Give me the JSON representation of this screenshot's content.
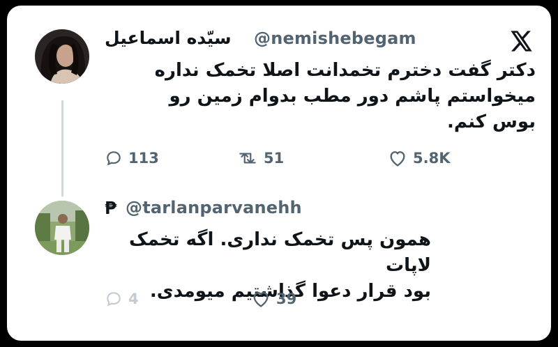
{
  "tweet1": {
    "display_name": "سیّده اسماعیل",
    "handle": "@nemishebegam",
    "lines": [
      "دکتر گفت دخترم تخمدانت اصلا تخمک نداره",
      "میخواستم پاشم دور مطب بدوام زمین رو",
      "بوس کنم."
    ],
    "replies": "113",
    "reposts": "51",
    "likes": "5.8K"
  },
  "tweet2": {
    "name_glyph": "₱",
    "handle": "@tarlanparvanehh",
    "lines": [
      "همون پس تخمک نداری. اگه تخمک لاپات",
      "بود قرار دعوا گذاشتیم میومدی."
    ],
    "replies": "4",
    "likes": "39"
  },
  "icons": [
    "x-logo-icon",
    "reply-icon",
    "repost-icon",
    "like-icon"
  ],
  "colors": {
    "text": "#0f1419",
    "muted": "#536471",
    "faded": "#c3ccd3",
    "thread_line": "#cfd9de"
  }
}
